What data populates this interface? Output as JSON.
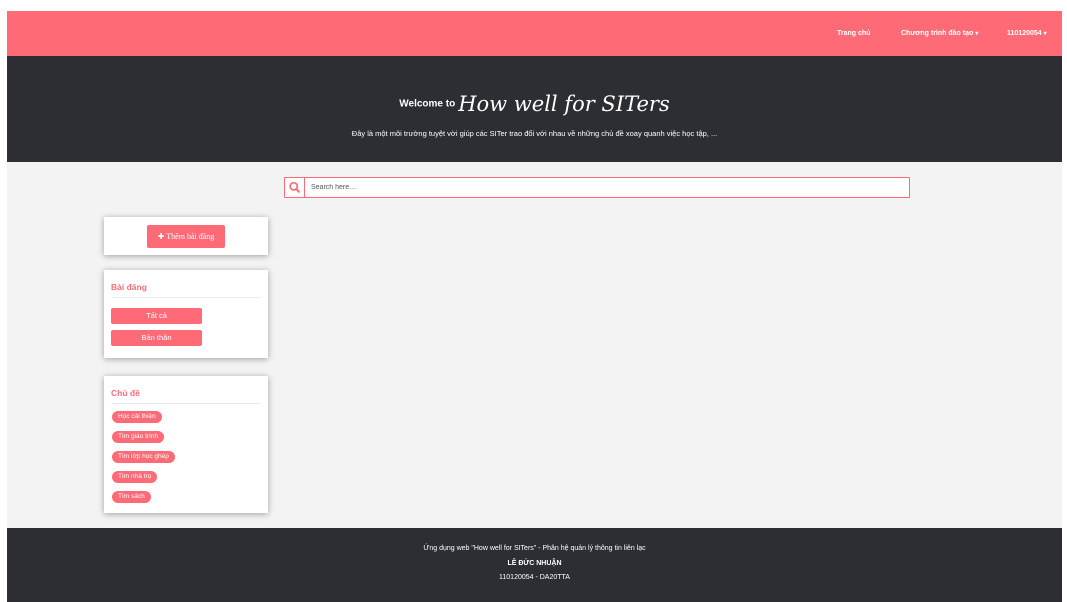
{
  "nav": {
    "home": "Trang chủ",
    "program": "Chương trình đào tạo",
    "user": "110120054"
  },
  "hero": {
    "welcome": "Welcome to",
    "brand": "How well for SITers",
    "subtitle": "Đây là một môi trường tuyệt vời giúp các SITer trao đổi với nhau về những chủ đề xoay quanh việc học tập, ..."
  },
  "search": {
    "placeholder": "Search here...."
  },
  "sidebar": {
    "add_post": "Thêm bài đăng",
    "posts": {
      "title": "Bài đăng",
      "items": [
        "Tất cả",
        "Bản thân"
      ]
    },
    "topics": {
      "title": "Chủ đề",
      "items": [
        "Học cải thiện",
        "Tìm giáo trình",
        "Tìm lớp học ghép",
        "Tìm nhà trọ",
        "Tìm sách"
      ]
    }
  },
  "footer": {
    "line1": "Ứng dụng web \"How well for SITers\" - Phân hệ quản lý thông tin liên lạc",
    "author": "LÊ ĐỨC NHUẬN",
    "line3": "110120054 - DA20TTA"
  },
  "colors": {
    "accent": "#fe6b77",
    "dark": "#2d2e33",
    "background": "#f3f3f3"
  }
}
